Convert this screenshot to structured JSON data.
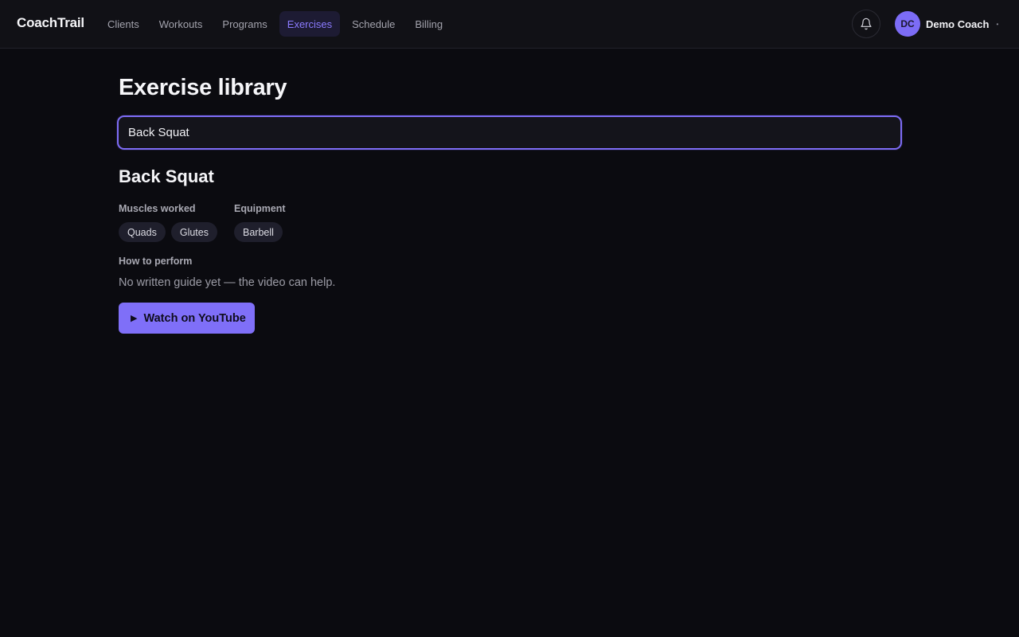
{
  "app": {
    "brand": "CoachTrail"
  },
  "nav": {
    "items": [
      {
        "label": "Clients",
        "active": false
      },
      {
        "label": "Workouts",
        "active": false
      },
      {
        "label": "Programs",
        "active": false
      },
      {
        "label": "Exercises",
        "active": true
      },
      {
        "label": "Schedule",
        "active": false
      },
      {
        "label": "Billing",
        "active": false
      }
    ]
  },
  "header": {
    "notifications_icon": "bell-icon",
    "user": {
      "initials": "DC",
      "name": "Demo Coach",
      "menu_icon": "chevron-down-icon"
    }
  },
  "page": {
    "title": "Exercise library",
    "search": {
      "value": "Back Squat"
    }
  },
  "exercise": {
    "name": "Back Squat",
    "muscles_label": "Muscles worked",
    "muscles": [
      "Quads",
      "Glutes"
    ],
    "equipment_label": "Equipment",
    "equipment": [
      "Barbell"
    ],
    "how_label": "How to perform",
    "guide_text": "No written guide yet — the video can help.",
    "video_button": {
      "icon": "play-icon",
      "label": "Watch on YouTube"
    }
  },
  "colors": {
    "accent": "#7f6ff8",
    "background": "#0b0b10",
    "topbar": "#111116",
    "chip": "#1f1f2c"
  }
}
